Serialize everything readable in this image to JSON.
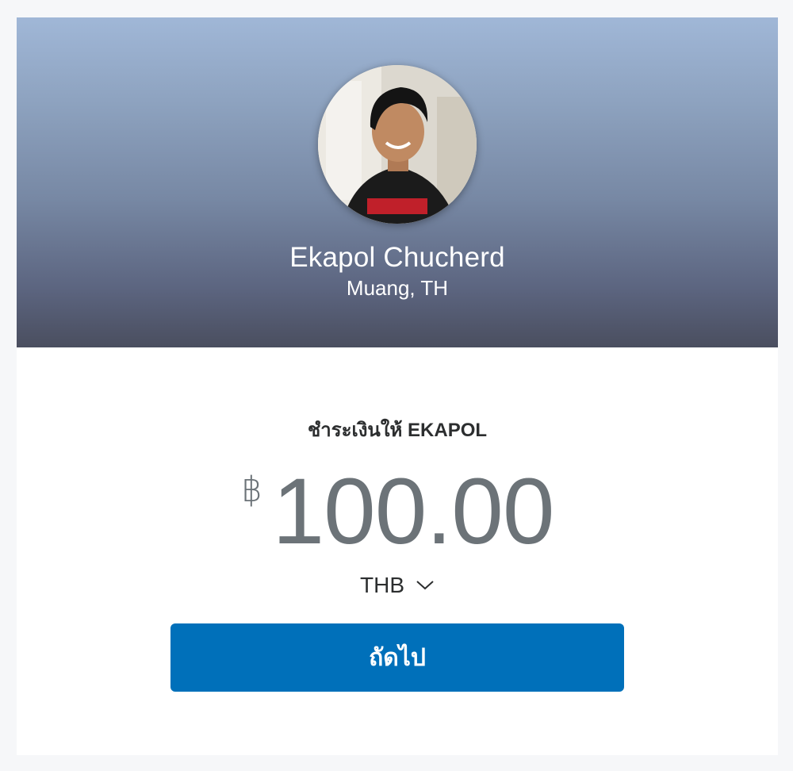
{
  "profile": {
    "name": "Ekapol Chucherd",
    "location": "Muang, TH"
  },
  "payment": {
    "pay_to_label": "ชำระเงินให้ EKAPOL",
    "currency_symbol": "฿",
    "amount": "100.00",
    "currency_code": "THB"
  },
  "actions": {
    "next_label": "ถัดไป"
  },
  "icons": {
    "currency_dropdown": "chevron-down-icon"
  },
  "colors": {
    "primary_button": "#0070ba",
    "amount_text": "#6c7378",
    "hero_gradient_top": "#a0b7d7",
    "hero_gradient_bottom": "#4a4e5f"
  }
}
